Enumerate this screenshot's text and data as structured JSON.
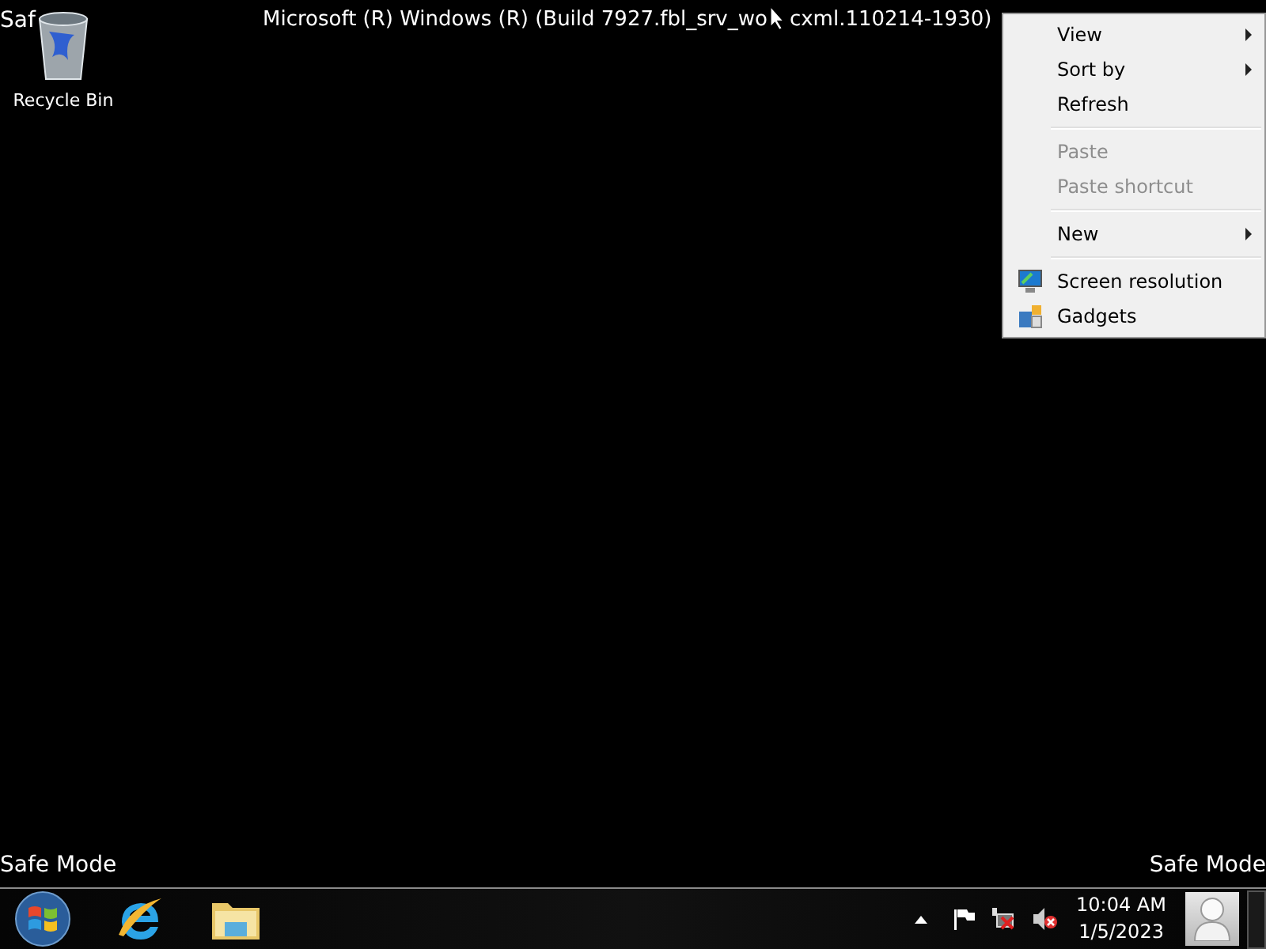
{
  "desktop": {
    "safe_mode_top_left": "Saf",
    "safe_mode_bottom_left": "Safe Mode",
    "safe_mode_bottom_right": "Safe Mode",
    "build_text_before_cursor": "Microsoft (R) Windows (R) (Build 7927.fbl_srv_wo",
    "build_text_after_cursor": "cxml.110214-1930)",
    "icons": [
      {
        "label": "Recycle Bin"
      }
    ]
  },
  "context_menu": {
    "items": [
      {
        "kind": "item",
        "label": "View",
        "submenu": true,
        "disabled": false
      },
      {
        "kind": "item",
        "label": "Sort by",
        "submenu": true,
        "disabled": false
      },
      {
        "kind": "item",
        "label": "Refresh",
        "submenu": false,
        "disabled": false
      },
      {
        "kind": "separator"
      },
      {
        "kind": "item",
        "label": "Paste",
        "submenu": false,
        "disabled": true
      },
      {
        "kind": "item",
        "label": "Paste shortcut",
        "submenu": false,
        "disabled": true
      },
      {
        "kind": "separator"
      },
      {
        "kind": "item",
        "label": "New",
        "submenu": true,
        "disabled": false
      },
      {
        "kind": "separator"
      },
      {
        "kind": "icon_item",
        "label": "Screen resolution",
        "submenu": false,
        "disabled": false
      },
      {
        "kind": "icon_item",
        "label": "Gadgets",
        "submenu": false,
        "disabled": false
      }
    ]
  },
  "taskbar": {
    "clock": {
      "time": "10:04 AM",
      "date": "1/5/2023"
    }
  }
}
